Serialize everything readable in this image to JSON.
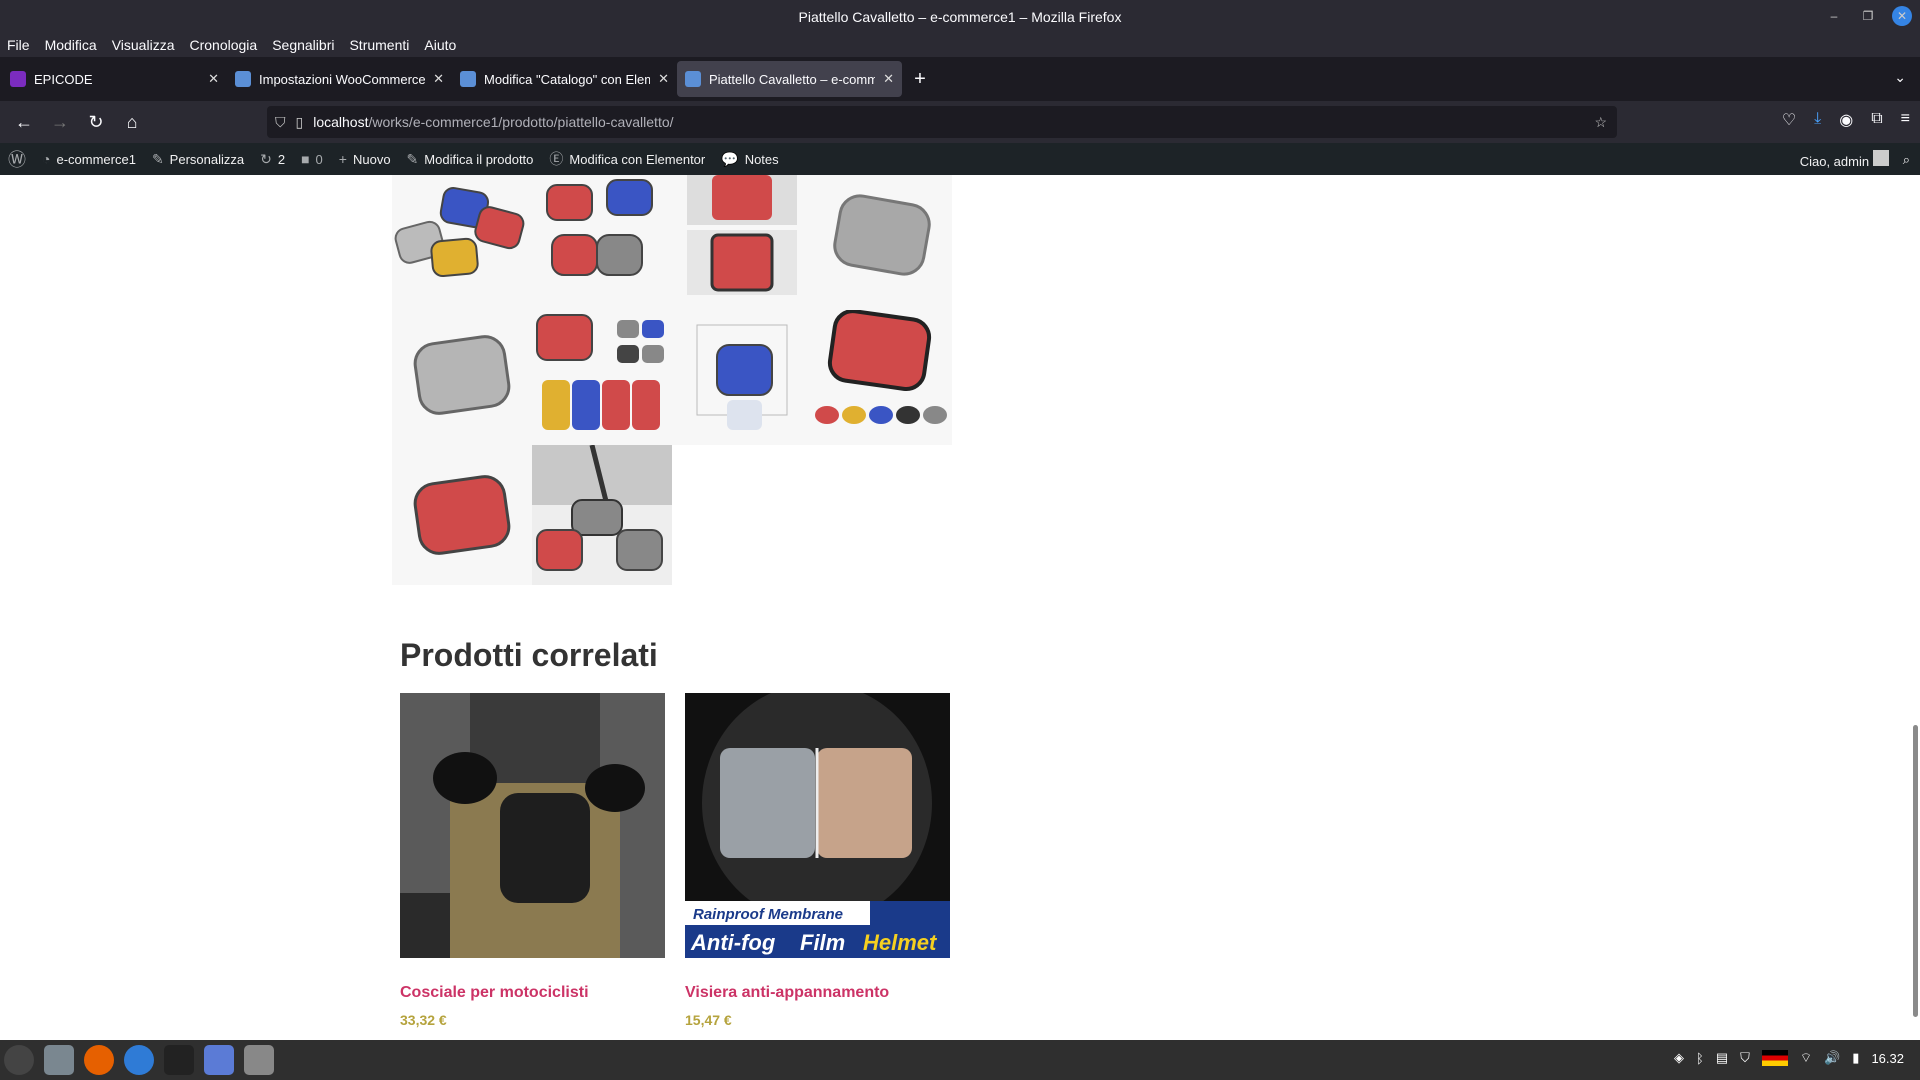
{
  "window": {
    "title": "Piattello Cavalletto – e-commerce1 – Mozilla Firefox"
  },
  "menu": [
    "File",
    "Modifica",
    "Visualizza",
    "Cronologia",
    "Segnalibri",
    "Strumenti",
    "Aiuto"
  ],
  "tabs": [
    {
      "title": "EPICODE",
      "favicon_color": "#7b2cbf"
    },
    {
      "title": "Impostazioni WooCommerce",
      "favicon_color": "#5b8fd6"
    },
    {
      "title": "Modifica \"Catalogo\" con Elementor",
      "favicon_color": "#5b8fd6"
    },
    {
      "title": "Piattello Cavalletto – e-commerce1",
      "favicon_color": "#5b8fd6"
    }
  ],
  "url": {
    "host": "localhost",
    "path": "/works/e-commerce1/prodotto/piattello-cavalletto/"
  },
  "wpbar": {
    "site": "e-commerce1",
    "customize": "Personalizza",
    "updates": "2",
    "comments": "0",
    "new": "Nuovo",
    "edit_product": "Modifica il prodotto",
    "elementor": "Modifica con Elementor",
    "notes": "Notes",
    "greeting": "Ciao, admin"
  },
  "related": {
    "title": "Prodotti correlati",
    "products": [
      {
        "name": "Cosciale per motociclisti",
        "price": "33,32 €"
      },
      {
        "name": "Visiera anti-appannamento",
        "price": "15,47 €"
      }
    ],
    "banner": {
      "line1": "Rainproof Membrane",
      "line2a": "Anti-fog",
      "line2b": "Film",
      "line2c": "Helmet"
    }
  },
  "gallery_colors": [
    "#c9c9c9",
    "#d04a4a",
    "#3a55c4",
    "#e0b030",
    "#444444"
  ],
  "taskbar": {
    "time": "16.32"
  }
}
